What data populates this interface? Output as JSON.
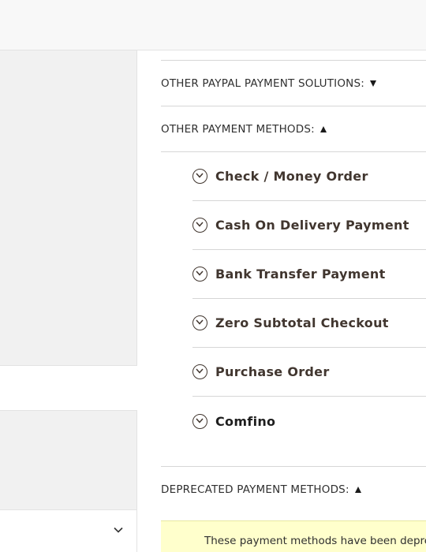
{
  "sections": {
    "paypal_other": "OTHER PAYPAL PAYMENT SOLUTIONS:",
    "other_methods": "OTHER PAYMENT METHODS:",
    "deprecated": "DEPRECATED PAYMENT METHODS:"
  },
  "methods": [
    "Check / Money Order",
    "Cash On Delivery Payment",
    "Bank Transfer Payment",
    "Zero Subtotal Checkout",
    "Purchase Order",
    "Comfino"
  ],
  "notice": "These payment methods have been deprecated",
  "icons": {
    "section_collapsed": "triangle-down-icon",
    "section_expanded": "triangle-up-icon",
    "method_toggle": "circle-chevron-down-icon",
    "dropdown": "chevron-down-icon"
  },
  "colors": {
    "notice_bg": "#ffffcc",
    "panel_bg": "#f1f1f1",
    "method_text": "#41362f"
  }
}
